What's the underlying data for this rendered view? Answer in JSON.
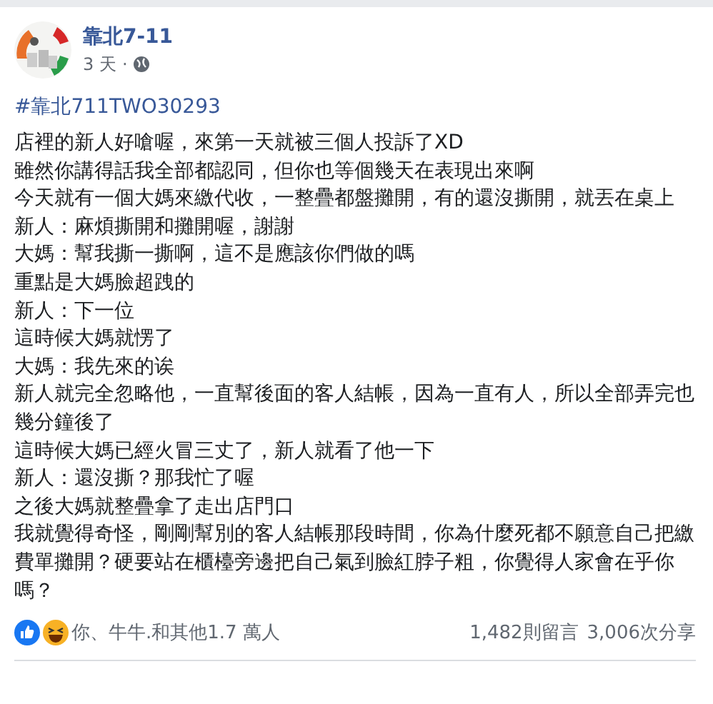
{
  "post": {
    "author": "靠北7-11",
    "time": "3 天",
    "separator": "·",
    "hashtag": "#靠北711TWO30293",
    "lines": [
      "店裡的新人好嗆喔，來第一天就被三個人投訴了XD",
      "雖然你講得話我全部都認同，但你也等個幾天在表現出來啊",
      "今天就有一個大媽來繳代收，一整疊都盤攤開，有的還沒撕開，就丟在桌上",
      "新人：麻煩撕開和攤開喔，謝謝",
      "大媽：幫我撕一撕啊，這不是應該你們做的嗎",
      "重點是大媽臉超跩的",
      "新人：下一位",
      "這時候大媽就愣了",
      "大媽：我先來的诶",
      "新人就完全忽略他，一直幫後面的客人結帳，因為一直有人，所以全部弄完也幾分鐘後了",
      "這時候大媽已經火冒三丈了，新人就看了他一下",
      "新人：還沒撕？那我忙了喔",
      "之後大媽就整疊拿了走出店門口",
      "我就覺得奇怪，剛剛幫別的客人結帳那段時間，你為什麼死都不願意自己把繳費單攤開？硬要站在櫃檯旁邊把自己氣到臉紅脖子粗，你覺得人家會在乎你嗎？"
    ],
    "reactions": "你、牛牛.和其他1.7 萬人",
    "comments": "1,482則留言",
    "shares": "3,006次分享"
  }
}
